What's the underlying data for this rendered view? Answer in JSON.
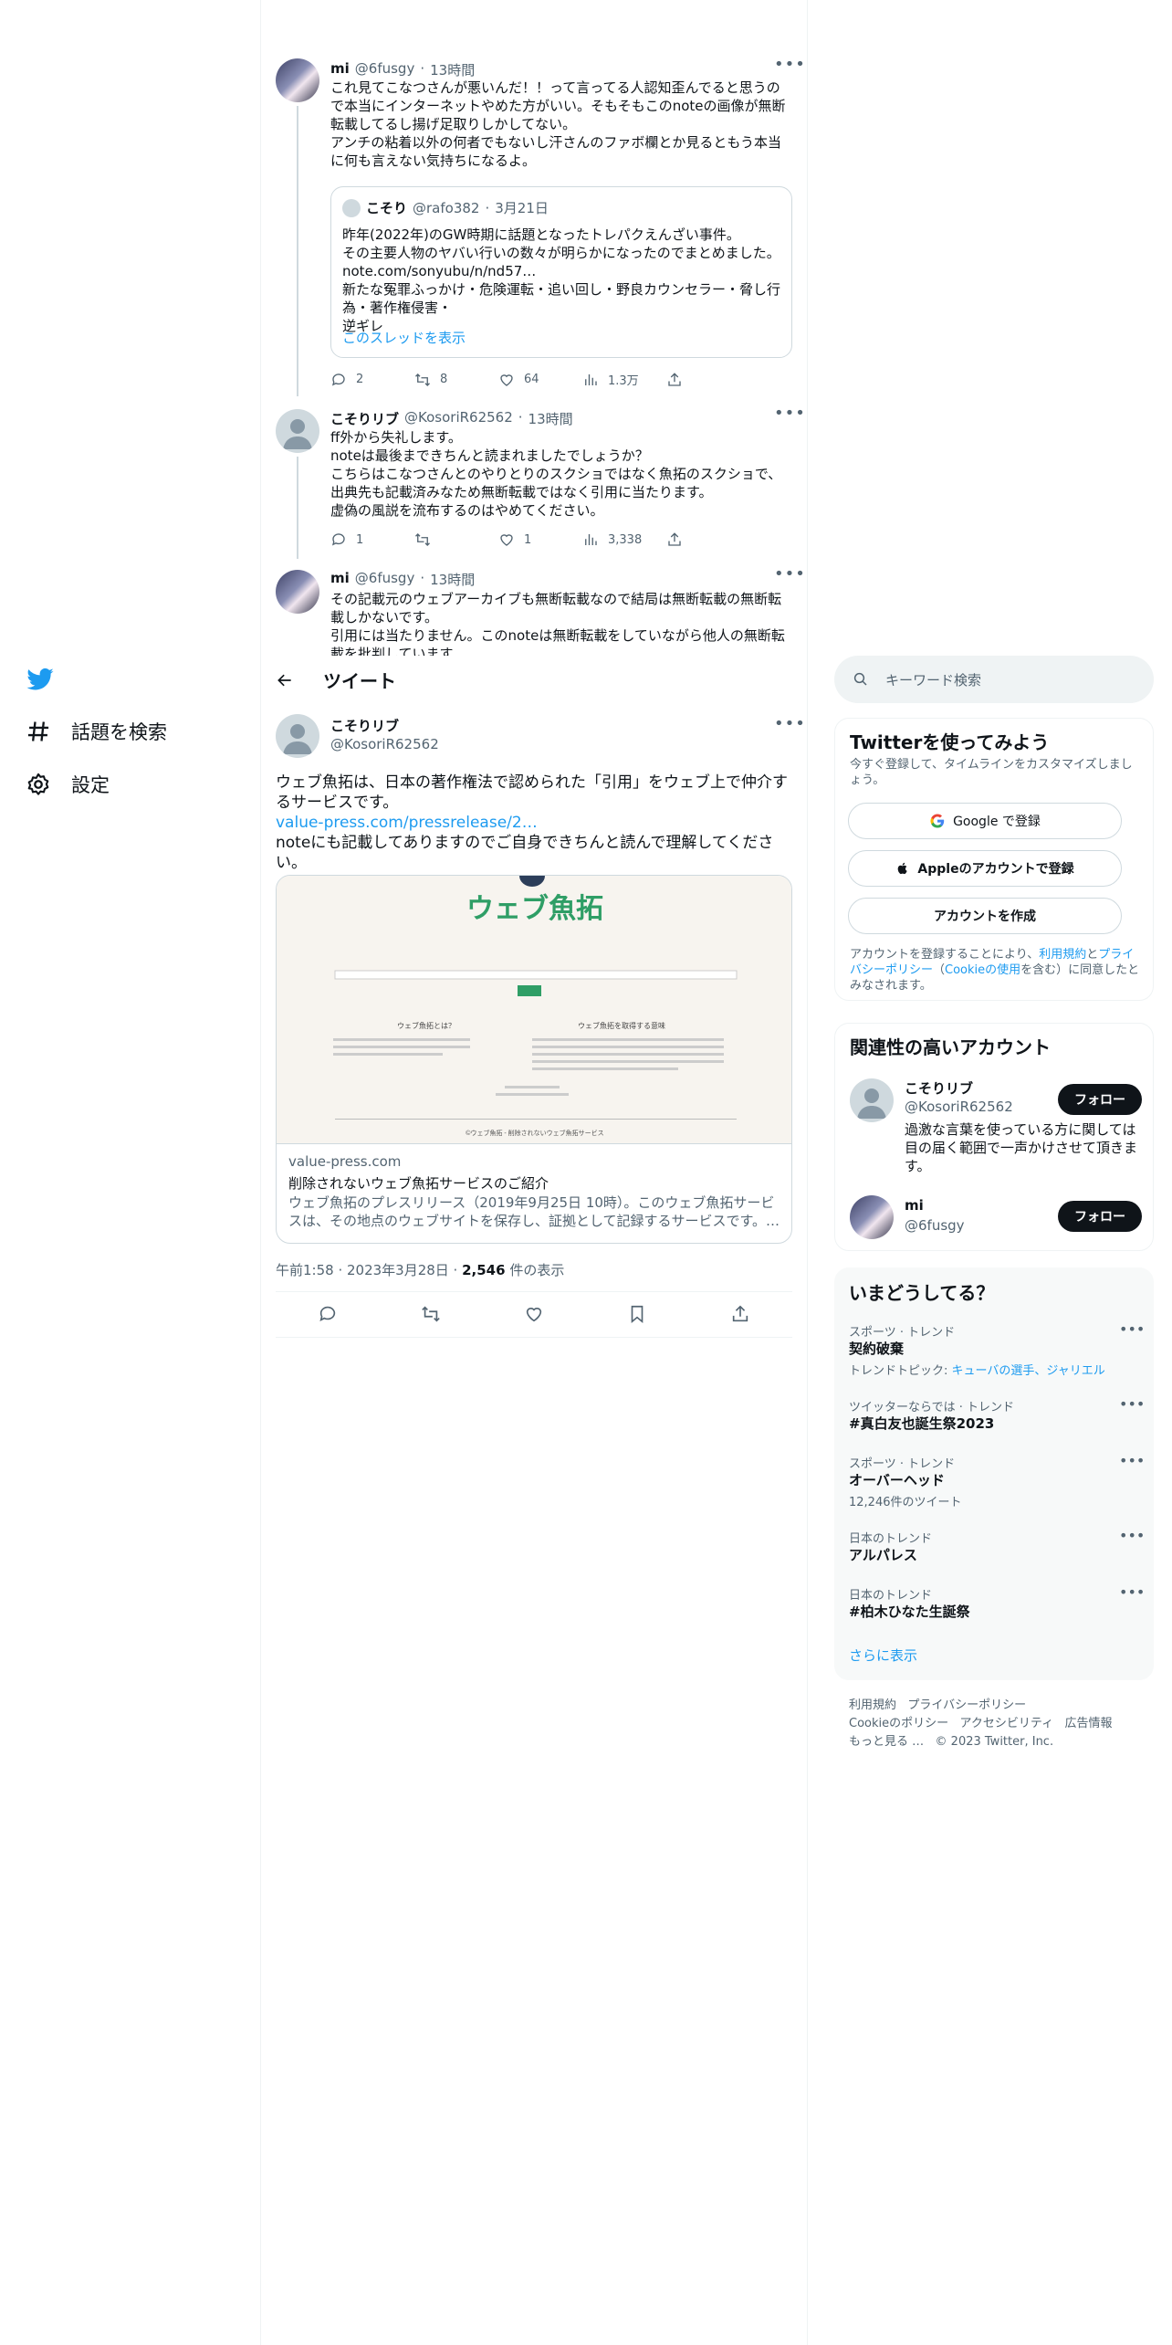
{
  "nav": {
    "search_label": "話題を検索",
    "settings_label": "設定"
  },
  "colors": {
    "accent": "#1d9bf0",
    "text": "#0f1419",
    "muted": "#536471",
    "border": "#cfd9de"
  },
  "thread": [
    {
      "name": "mi",
      "handle": "@6fusgy",
      "time": "13時間",
      "text": "これ見てこなつさんが悪いんだ！！って言ってる人認知歪んでると思うので本当にインターネットやめた方がいい。そもそもこのnoteの画像が無断転載してるし揚げ足取りしかしてない。\nアンチの粘着以外の何者でもないし汗さんのファボ欄とか見るともう本当に何も言えない気持ちになるよ。",
      "quote": {
        "name": "こそり",
        "handle": "@rafo382",
        "time": "3月21日",
        "text": "昨年(2022年)のGW時期に話題となったトレパクえんざい事件。\nその主要人物のヤバい行いの数々が明らかになったのでまとめました。\nnote.com/sonyubu/n/nd57…\n新たな冤罪ふっかけ・危険運転・追い回し・野良カウンセラー・脅し行為・著作権侵害・\n逆ギレ",
        "show_thread": "このスレッドを表示"
      },
      "replies": "2",
      "retweets": "8",
      "likes": "64",
      "views": "1.3万"
    },
    {
      "name": "こそりリブ",
      "handle": "@KosoriR62562",
      "time": "13時間",
      "text": "ff外から失礼します。\nnoteは最後まできちんと読まれましたでしょうか？\nこちらはこなつさんとのやりとりのスクショではなく魚拓のスクショで、出典先も記載済みなため無断転載ではなく引用に当たります。\n虚偽の風説を流布するのはやめてください。",
      "replies": "1",
      "retweets": "",
      "likes": "1",
      "views": "3,338"
    },
    {
      "name": "mi",
      "handle": "@6fusgy",
      "time": "13時間",
      "text": "その記載元のウェブアーカイブも無断転載なので結局は無断転載の無断転載しかないです。\n引用には当たりません。このnoteは無断転載をしていながら他人の無断転載を批判しています"
    }
  ],
  "header": {
    "title": "ツイート"
  },
  "main": {
    "name": "こそりリブ",
    "handle": "@KosoriR62562",
    "text_1": "ウェブ魚拓は、日本の著作権法で認められた「引用」をウェブ上で仲介するサービスです。",
    "link": "value-press.com/pressrelease/2…",
    "text_2": "noteにも記載してありますのでご自身できちんと読んで理解してください。",
    "card": {
      "logo_text": "ウェブ魚拓",
      "domain": "value-press.com",
      "title": "削除されないウェブ魚拓サービスのご紹介",
      "description": "ウェブ魚拓のプレスリリース（2019年9月25日 10時）。このウェブ魚拓サービスは、その地点のウェブサイトを保存し、証拠として記録するサービスです。…",
      "image_caption": "©ウェブ魚拓 - 削除されないウェブ魚拓サービス"
    },
    "timestamp": "午前1:58 · 2023年3月28日 · ",
    "views_count": "2,546",
    "views_label": " 件の表示"
  },
  "search": {
    "placeholder": "キーワード検索"
  },
  "signup": {
    "title": "Twitterを使ってみよう",
    "subtitle": "今すぐ登録して、タイムラインをカスタマイズしましょう。",
    "google": "Google で登録",
    "apple": "Appleのアカウントで登録",
    "create": "アカウントを作成",
    "terms_1": "アカウントを登録することにより、",
    "terms_link_1": "利用規約",
    "terms_2": "と",
    "terms_link_2": "プライバシーポリシー",
    "terms_3": "（",
    "terms_link_3": "Cookieの使用",
    "terms_4": "を含む）に同意したとみなされます。"
  },
  "related": {
    "title": "関連性の高いアカウント",
    "accounts": [
      {
        "name": "こそりリブ",
        "handle": "@KosoriR62562",
        "bio": "過激な言葉を使っている方に関しては目の届く範囲で一声かけさせて頂きます。",
        "follow": "フォロー"
      },
      {
        "name": "mi",
        "handle": "@6fusgy",
        "bio": "",
        "follow": "フォロー"
      }
    ]
  },
  "trends": {
    "title": "いまどうしてる？",
    "items": [
      {
        "meta": "スポーツ · トレンド",
        "name": "契約破棄",
        "extra_prefix": "トレンドトピック: ",
        "extra_link": "キューバの選手、ジャリエル"
      },
      {
        "meta": "ツイッターならでは · トレンド",
        "name": "#真白友也誕生祭2023"
      },
      {
        "meta": "スポーツ · トレンド",
        "name": "オーバーヘッド",
        "extra": "12,246件のツイート"
      },
      {
        "meta": "日本のトレンド",
        "name": "アルパレス"
      },
      {
        "meta": "日本のトレンド",
        "name": "#柏木ひなた生誕祭"
      }
    ],
    "show_more": "さらに表示"
  },
  "footer": {
    "line1": [
      "利用規約",
      "プライバシーポリシー"
    ],
    "line2": [
      "Cookieのポリシー",
      "アクセシビリティ",
      "広告情報"
    ],
    "more": "もっと見る …",
    "copyright": "© 2023 Twitter, Inc."
  }
}
